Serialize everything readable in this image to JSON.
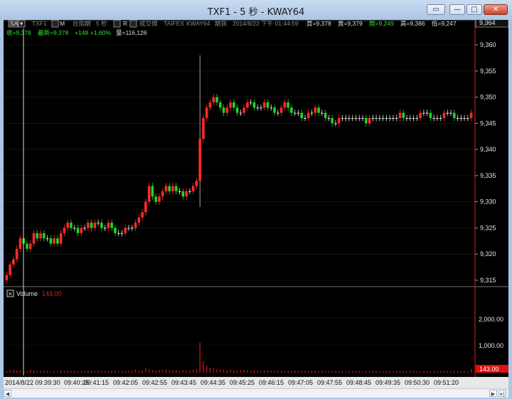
{
  "window": {
    "title": "TXF1 - 5 秒 - KWAY64",
    "buttons": {
      "restore": "▭",
      "minimize": "—",
      "maximize": "□",
      "close": "✕"
    }
  },
  "toolbar": {
    "period": "SAI",
    "symbol": "TXF1",
    "btn_m": "M",
    "exchange_name": "台指期",
    "interval": "5 秒",
    "btn_r": "R",
    "price_type": "成交價",
    "feed": "TAIFEX",
    "account": "KWAY64",
    "category": "期貨",
    "datetime": "2014/8/22 下午 01:44:59",
    "bid": "買=9,378",
    "ask": "賣=9,379",
    "open": "開=9,249",
    "high": "高=9,386",
    "low": "低=9,247"
  },
  "quote": {
    "close": "收=9,378",
    "last": "最新=9,378",
    "change": "+148",
    "change_pct": "+1.60%",
    "volume": "量=116,126"
  },
  "volume_panel": {
    "label": "Volume",
    "value": "143.00",
    "last_tag": "143.00"
  },
  "price_axis": {
    "current": "9,364",
    "ticks": [
      "9,360",
      "9,355",
      "9,350",
      "9,345",
      "9,340",
      "9,335",
      "9,330",
      "9,325",
      "9,320",
      "9,315"
    ]
  },
  "volume_axis": {
    "ticks": [
      "2,000.00",
      "1,000.00"
    ]
  },
  "time_axis": {
    "start": "2014/8/22 09:39:30",
    "ticks": [
      "09:40:25",
      "09:41:15",
      "09:42:05",
      "09:42:55",
      "09:43:45",
      "09:44:35",
      "09:45:25",
      "09:46:15",
      "09:47:05",
      "09:47:55",
      "09:48:45",
      "09:49:35",
      "09:50:30",
      "09:51:20"
    ]
  },
  "colors": {
    "up": "#ff2a2a",
    "down": "#21d321",
    "flat": "#e0e0e0",
    "grid": "#4a4a4a",
    "label_green": "#2fe02f"
  },
  "series": {
    "closes": [
      9316,
      9318,
      9319,
      9321,
      9323,
      9322,
      9321,
      9322,
      9324,
      9323,
      9324,
      9323,
      9323,
      9322,
      9323,
      9322,
      9324,
      9325,
      9326,
      9325,
      9325,
      9324,
      9325,
      9325,
      9326,
      9325,
      9326,
      9326,
      9325,
      9325,
      9326,
      9325,
      9324,
      9324,
      9324,
      9325,
      9325,
      9325,
      9326,
      9327,
      9328,
      9330,
      9333,
      9331,
      9330,
      9331,
      9332,
      9333,
      9332,
      9333,
      9332,
      9332,
      9331,
      9332,
      9332,
      9333,
      9334,
      9342,
      9346,
      9348,
      9349,
      9350,
      9349,
      9348,
      9347,
      9348,
      9349,
      9348,
      9347,
      9347,
      9348,
      9349,
      9349,
      9348,
      9348,
      9348,
      9349,
      9348,
      9348,
      9347,
      9347,
      9348,
      9349,
      9348,
      9347,
      9347,
      9347,
      9346,
      9346,
      9347,
      9347,
      9348,
      9347,
      9347,
      9346,
      9346,
      9345,
      9345,
      9346,
      9346,
      9346,
      9346,
      9346,
      9346,
      9346,
      9346,
      9345,
      9346,
      9346,
      9346,
      9346,
      9346,
      9346,
      9346,
      9346,
      9346,
      9347,
      9346,
      9346,
      9346,
      9346,
      9346,
      9347,
      9347,
      9347,
      9346,
      9346,
      9346,
      9346,
      9347,
      9347,
      9347,
      9346,
      9346,
      9346,
      9346,
      9346,
      9347
    ],
    "volumes": [
      60,
      90,
      110,
      70,
      80,
      50,
      60,
      130,
      70,
      60,
      80,
      70,
      60,
      50,
      60,
      70,
      90,
      60,
      80,
      60,
      70,
      50,
      60,
      60,
      70,
      80,
      60,
      90,
      60,
      70,
      60,
      70,
      80,
      60,
      60,
      60,
      70,
      80,
      110,
      80,
      90,
      160,
      120,
      100,
      80,
      90,
      100,
      110,
      90,
      80,
      90,
      70,
      90,
      80,
      90,
      110,
      120,
      1100,
      420,
      260,
      180,
      160,
      120,
      110,
      100,
      90,
      120,
      90,
      80,
      90,
      100,
      80,
      70,
      90,
      80,
      70,
      80,
      90,
      70,
      70,
      80,
      70,
      60,
      60,
      70,
      80,
      60,
      70,
      80,
      60,
      60,
      70,
      60,
      70,
      60,
      60,
      70,
      60,
      60,
      60,
      50,
      60,
      70,
      60,
      60,
      50,
      60,
      60,
      70,
      60,
      60,
      50,
      60,
      60,
      60,
      70,
      60,
      60,
      60,
      60,
      70,
      60,
      60,
      60,
      60,
      60,
      60,
      60,
      60,
      60,
      70,
      60,
      60,
      60,
      60,
      60,
      60,
      143
    ]
  }
}
